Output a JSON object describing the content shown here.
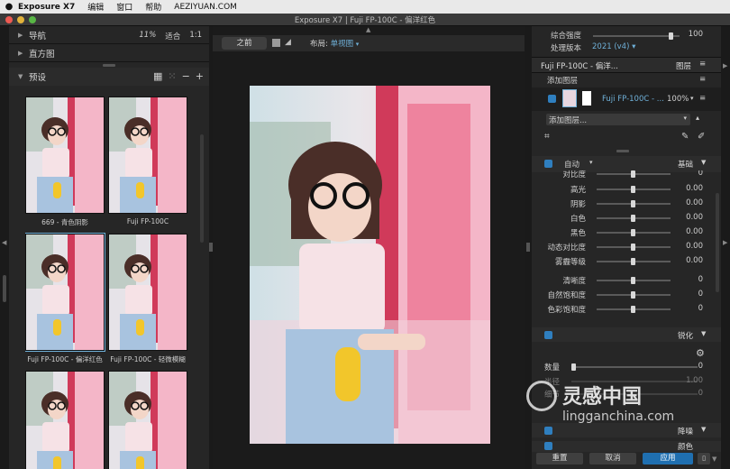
{
  "menubar": {
    "apple": "",
    "app": "Exposure X7",
    "edit": "编辑",
    "window": "窗口",
    "help": "帮助",
    "site": "AEZIYUAN.COM"
  },
  "window": {
    "title": "Exposure X7 | Fuji FP-100C - 偏洋红色"
  },
  "left": {
    "nav": "导航",
    "zoom_pct": "11%",
    "fit": "适合",
    "ratio": "1:1",
    "histogram": "直方图",
    "presets": "预设",
    "thumbs": [
      {
        "label": "669 - 青色阴影"
      },
      {
        "label": "Fuji FP-100C"
      },
      {
        "label": "Fuji FP-100C - 偏洋红色"
      },
      {
        "label": "Fuji FP-100C - 轻微模糊"
      },
      {
        "label": ""
      },
      {
        "label": ""
      }
    ]
  },
  "center": {
    "before": "之前",
    "layout_label": "布局:",
    "layout_value": "单视图"
  },
  "right": {
    "overall_strength": "综合强度",
    "overall_value": "100",
    "process_version": "处理版本",
    "process_value": "2021 (v4)",
    "layer_name": "Fuji FP-100C - 偏洋...",
    "layers": "图层",
    "add_layer": "添加图层",
    "layer_item": "Fuji FP-100C - ...",
    "layer_opacity": "100%",
    "add_layer_dropdown": "添加图层...",
    "auto": "自动",
    "basic": "基础",
    "adjustments": [
      {
        "label": "对比度",
        "value": "0"
      },
      {
        "label": "高光",
        "value": "0.00"
      },
      {
        "label": "阴影",
        "value": "0.00"
      },
      {
        "label": "白色",
        "value": "0.00"
      },
      {
        "label": "黑色",
        "value": "0.00"
      },
      {
        "label": "动态对比度",
        "value": "0.00"
      },
      {
        "label": "雾霾等级",
        "value": "0.00"
      },
      {
        "label": "清晰度",
        "value": "0"
      },
      {
        "label": "自然饱和度",
        "value": "0"
      },
      {
        "label": "色彩饱和度",
        "value": "0"
      }
    ],
    "sharpen": "锐化",
    "amount": "数量",
    "amount_value": "0",
    "radius": "半径",
    "radius_value": "1.00",
    "detail": "细节",
    "detail_value": "0",
    "denoise": "降噪",
    "color": "颜色"
  },
  "buttons": {
    "reset": "重置",
    "cancel": "取消",
    "apply": "应用"
  },
  "watermark": {
    "cn": "灵感中国",
    "url": "lingganchina.com"
  },
  "colors": {
    "accent": "#6fb0d8",
    "apply_bg": "#1f6fb0",
    "panel": "#262626"
  }
}
